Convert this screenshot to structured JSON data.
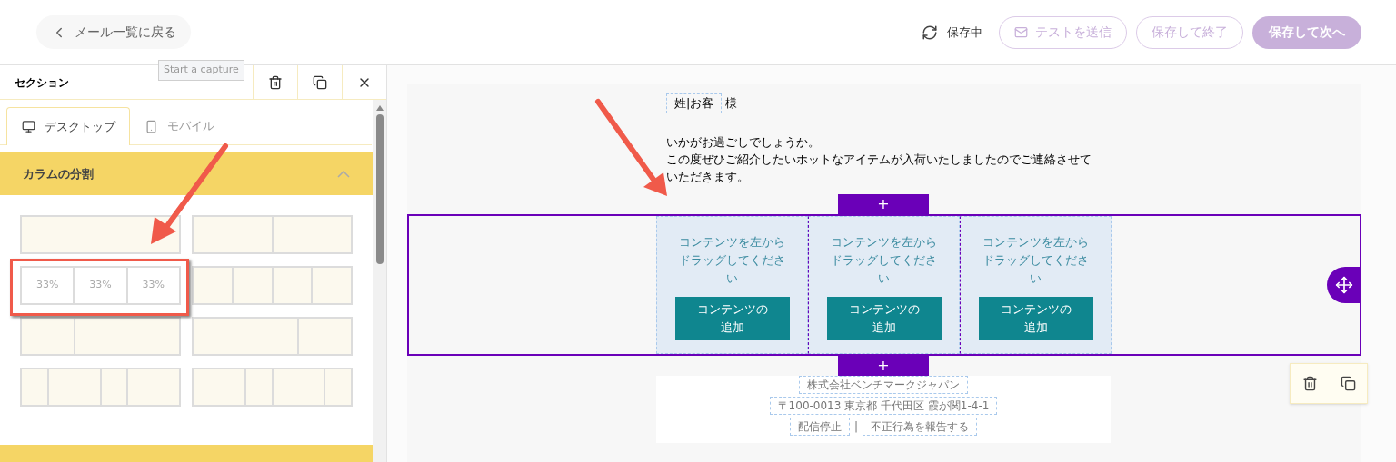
{
  "header": {
    "back_button": "メール一覧に戻る",
    "status": "保存中",
    "buttons": [
      {
        "label": "テストを送信",
        "kind": "outline-mail"
      },
      {
        "label": "保存して終了",
        "kind": "outline"
      },
      {
        "label": "保存して次へ",
        "kind": "filled"
      }
    ]
  },
  "tooltip": "Start a capture",
  "panel": {
    "title": "セクション",
    "tabs": [
      {
        "label": "デスクトップ",
        "kind": "desktop",
        "selected": true
      },
      {
        "label": "モバイル",
        "kind": "mobile",
        "selected": false
      }
    ],
    "accordion": {
      "title": "カラムの分割",
      "expanded": true
    },
    "layouts": [
      {
        "kind": "one",
        "selected": false
      },
      {
        "kind": "halves",
        "selected": false
      },
      {
        "kind": "thirds",
        "selected": true,
        "labels": [
          "33%",
          "33%",
          "33%"
        ]
      },
      {
        "kind": "quarters",
        "selected": false
      },
      {
        "kind": "third-twothirds",
        "selected": false
      },
      {
        "kind": "twothirds-third",
        "selected": false
      },
      {
        "kind": "mixed-a",
        "selected": false
      },
      {
        "kind": "mixed-b",
        "selected": false
      }
    ]
  },
  "email": {
    "greeting": {
      "merge_tag": "姓|お客",
      "suffix": "様"
    },
    "body": [
      "いかがお過ごしでしょうか。",
      "この度ぜひご紹介したいホットなアイテムが入荷いたしましたのでご連絡させていただきます。"
    ],
    "add_buttons": [
      "+",
      "+"
    ],
    "columns": [
      {
        "hint": "コンテンツを左からドラッグしてください",
        "button": "コンテンツの追加"
      },
      {
        "hint": "コンテンツを左からドラッグしてください",
        "button": "コンテンツの追加"
      },
      {
        "hint": "コンテンツを左からドラッグしてください",
        "button": "コンテンツの追加"
      }
    ],
    "footer": {
      "company": "株式会社ベンチマークジャパン",
      "address": "〒100-0013 東京都 千代田区 霞が関1-4-1",
      "links": [
        "配信停止",
        "不正行為を報告する"
      ],
      "separator": "|"
    }
  }
}
